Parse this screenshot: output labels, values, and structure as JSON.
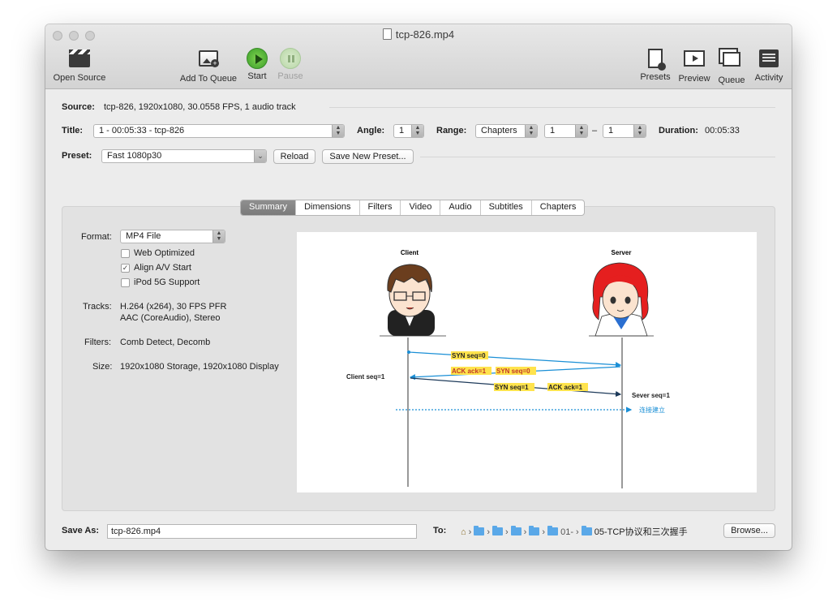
{
  "window": {
    "title": "tcp-826.mp4"
  },
  "toolbar": {
    "open_source": "Open Source",
    "add_to_queue": "Add To Queue",
    "start": "Start",
    "pause": "Pause",
    "presets": "Presets",
    "preview": "Preview",
    "queue": "Queue",
    "activity": "Activity"
  },
  "source": {
    "label": "Source:",
    "value": "tcp-826, 1920x1080, 30.0558 FPS, 1 audio track"
  },
  "title_row": {
    "title_label": "Title:",
    "title_value": "1 - 00:05:33 - tcp-826",
    "angle_label": "Angle:",
    "angle_value": "1",
    "range_label": "Range:",
    "range_mode": "Chapters",
    "range_start": "1",
    "range_dash": "–",
    "range_end": "1",
    "duration_label": "Duration:",
    "duration_value": "00:05:33"
  },
  "preset_row": {
    "label": "Preset:",
    "value": "Fast 1080p30",
    "reload": "Reload",
    "save_new": "Save New Preset..."
  },
  "tabs": [
    "Summary",
    "Dimensions",
    "Filters",
    "Video",
    "Audio",
    "Subtitles",
    "Chapters"
  ],
  "summary": {
    "format_label": "Format:",
    "format_value": "MP4 File",
    "web_optimized": "Web Optimized",
    "web_optimized_checked": false,
    "align_av": "Align A/V Start",
    "align_av_checked": true,
    "ipod": "iPod 5G Support",
    "ipod_checked": false,
    "tracks_label": "Tracks:",
    "tracks_line1": "H.264 (x264), 30 FPS PFR",
    "tracks_line2": "AAC (CoreAudio), Stereo",
    "filters_label": "Filters:",
    "filters_value": "Comb Detect, Decomb",
    "size_label": "Size:",
    "size_value": "1920x1080 Storage, 1920x1080 Display"
  },
  "preview_diagram": {
    "client": "Client",
    "server": "Server",
    "syn": "SYN  seq=0",
    "ack_syn_a": "ACK  ack=1",
    "ack_syn_b": "SYN  seq=0",
    "client_seq": "Client seq=1",
    "syn2": "SYN  seq=1",
    "ack2": "ACK  ack=1",
    "server_seq": "Sever seq=1",
    "established": "连接建立",
    "colors": {
      "arrow_blue": "#1a8fd6",
      "highlight": "#ffe34d",
      "hair_client": "#6b3e1e",
      "hair_server": "#e51f1f"
    }
  },
  "save": {
    "label": "Save As:",
    "value": "tcp-826.mp4",
    "to_label": "To:",
    "path_partial": "01-",
    "path_last": "05-TCP协议和三次握手",
    "browse": "Browse..."
  }
}
